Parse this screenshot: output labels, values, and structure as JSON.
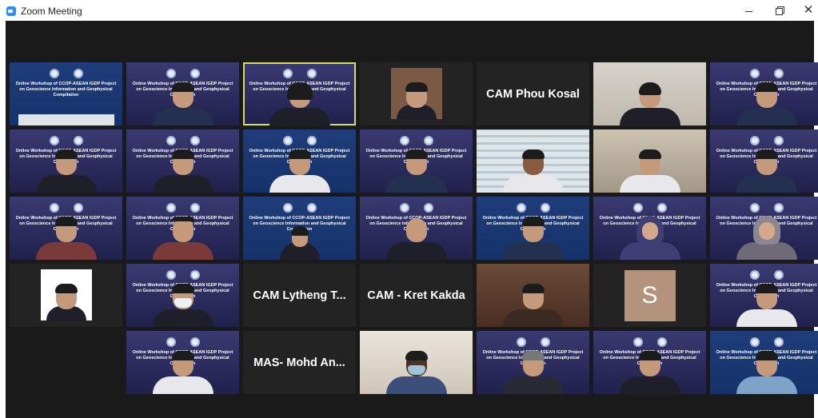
{
  "window": {
    "title": "Zoom Meeting",
    "minimize": "–",
    "restore": "❐",
    "close": "✕"
  },
  "slide_text": "Online Workshop of CCOP-ASEAN IGDP Project on Geoscience Information and Geophysical Compilation",
  "name_tiles": {
    "phou": "CAM Phou Kosal",
    "lytheng": "CAM Lytheng T...",
    "kret": "CAM - Kret Kakda",
    "mohd": "MAS- Mohd An...",
    "s_letter": "S"
  },
  "colors": {
    "active_speaker": "#d4e157",
    "meeting_bg": "#1a1a1a",
    "avatar_s": "#b4937d"
  }
}
